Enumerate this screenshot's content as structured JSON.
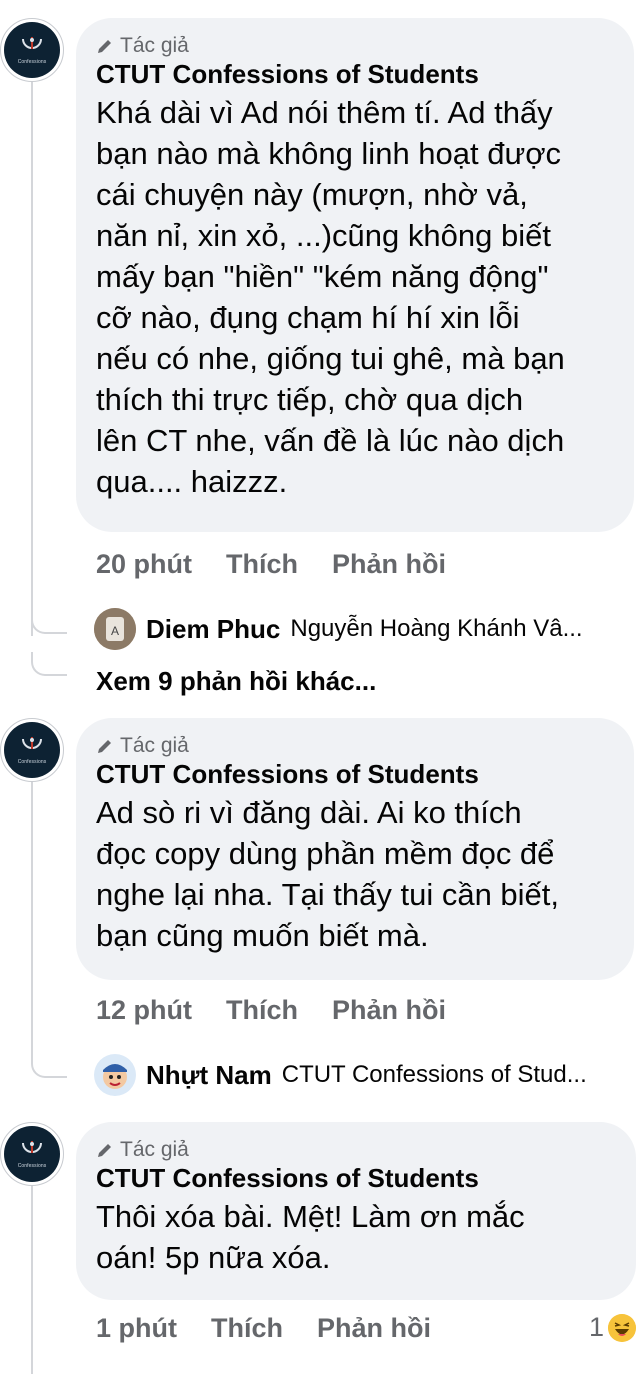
{
  "comments": [
    {
      "avatar_text": "Confessions",
      "badge": "Tác giả",
      "author": "CTUT Confessions of Students",
      "text_lines": [
        "Khá dài vì Ad nói thêm tí. Ad thấy",
        "bạn nào mà không linh hoạt được",
        "cái chuyện này (mượn, nhờ vả,",
        "năn nỉ, xin xỏ, ...)cũng không biết",
        "mấy bạn \"hiền\"  \"kém năng động\"",
        "cỡ nào, đụng chạm hí hí xin lỗi",
        "nếu có nhe, giống tui ghê, mà bạn",
        "thích thi trực tiếp, chờ qua dịch",
        "lên CT nhe, vấn đề là lúc nào dịch",
        "qua.... haizzz."
      ],
      "time": "20 phút",
      "like": "Thích",
      "reply": "Phản hồi",
      "reply_preview": {
        "name": "Diem Phuc",
        "text": "Nguyễn Hoàng Khánh Vâ..."
      },
      "more_replies": "Xem 9 phản hồi khác..."
    },
    {
      "avatar_text": "Confessions",
      "badge": "Tác giả",
      "author": "CTUT Confessions of Students",
      "text_lines": [
        "Ad sò ri vì đăng dài. Ai ko thích",
        "đọc copy dùng phần mềm đọc để",
        "nghe lại nha. Tại thấy tui cần biết,",
        "bạn cũng muốn biết mà."
      ],
      "time": "12 phút",
      "like": "Thích",
      "reply": "Phản hồi",
      "reply_preview": {
        "name": "Nhựt Nam",
        "text": "CTUT Confessions of Stud..."
      }
    },
    {
      "avatar_text": "Confessions",
      "badge": "Tác giả",
      "author": "CTUT Confessions of Students",
      "text_lines": [
        "Thôi xóa bài. Mệt! Làm ơn mắc",
        "oán! 5p nữa xóa."
      ],
      "time": "1 phút",
      "like": "Thích",
      "reply": "Phản hồi",
      "reaction": {
        "count": "1",
        "icon": "haha-icon"
      }
    }
  ],
  "colors": {
    "bubble": "#f0f2f5",
    "secondary_text": "#65676b",
    "primary_text": "#050505",
    "avatar_bg": "#0d2233"
  }
}
